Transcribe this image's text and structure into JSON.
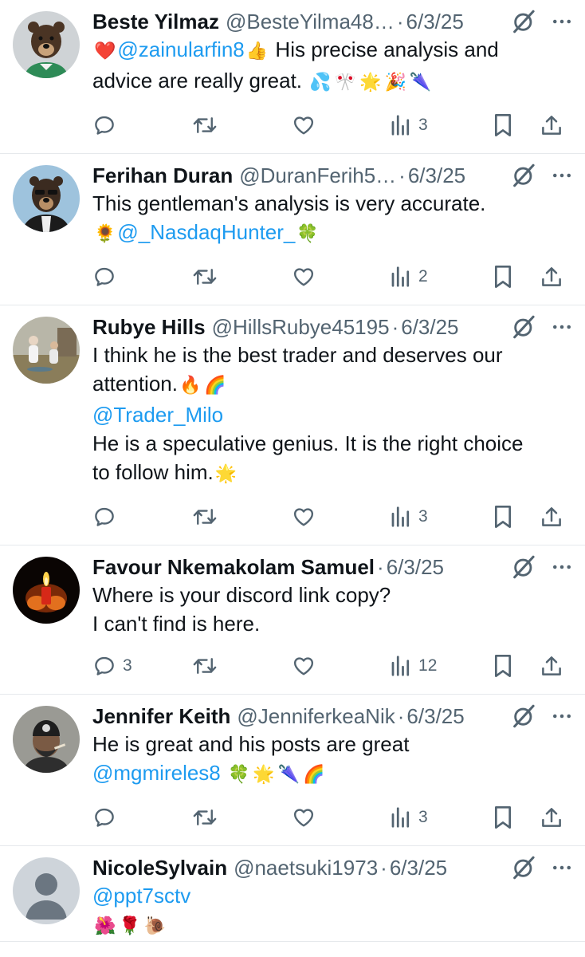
{
  "tweets": [
    {
      "name": "Beste Yilmaz",
      "handle": "@BesteYilma48…",
      "date": "6/3/25",
      "lines": [
        [
          {
            "t": "e",
            "v": "❤️"
          },
          {
            "t": "m",
            "v": "@zainularfin8"
          },
          {
            "t": "e",
            "v": "👍"
          },
          {
            "t": "x",
            "v": " His precise analysis and"
          }
        ],
        [
          {
            "t": "x",
            "v": "advice are really great. "
          },
          {
            "t": "e",
            "v": "💦"
          },
          {
            "t": "e",
            "v": "🎌"
          },
          {
            "t": "e",
            "v": "🌟"
          },
          {
            "t": "e",
            "v": "🎉"
          },
          {
            "t": "e",
            "v": "🌂"
          }
        ]
      ],
      "reply_count": "",
      "view_count": "3",
      "avatar": "bear-green"
    },
    {
      "name": "Ferihan Duran",
      "handle": "@DuranFerih5…",
      "date": "6/3/25",
      "lines": [
        [
          {
            "t": "x",
            "v": "This gentleman's analysis is very accurate."
          }
        ],
        [
          {
            "t": "e",
            "v": "🌻"
          },
          {
            "t": "m",
            "v": "@_NasdaqHunter_"
          },
          {
            "t": "e",
            "v": "🍀"
          }
        ]
      ],
      "reply_count": "",
      "view_count": "2",
      "avatar": "bear-blue"
    },
    {
      "name": "Rubye Hills",
      "handle": "@HillsRubye45195",
      "date": "6/3/25",
      "lines": [
        [
          {
            "t": "x",
            "v": "I think he is the best trader and deserves our"
          }
        ],
        [
          {
            "t": "x",
            "v": "attention."
          },
          {
            "t": "e",
            "v": "🔥"
          },
          {
            "t": "e",
            "v": "🌈"
          }
        ],
        [
          {
            "t": "m",
            "v": "@Trader_Milo"
          }
        ],
        [
          {
            "t": "x",
            "v": "He is a speculative genius. It is the right choice"
          }
        ],
        [
          {
            "t": "x",
            "v": "to follow him."
          },
          {
            "t": "e",
            "v": "🌟"
          }
        ]
      ],
      "reply_count": "",
      "view_count": "3",
      "avatar": "photo"
    },
    {
      "name": "Favour Nkemakolam Samuel",
      "handle": "",
      "date": "6/3/25",
      "lines": [
        [
          {
            "t": "x",
            "v": "Where is your discord link copy?"
          }
        ],
        [
          {
            "t": "x",
            "v": "I can't find is here."
          }
        ]
      ],
      "reply_count": "3",
      "view_count": "12",
      "avatar": "candle"
    },
    {
      "name": "Jennifer Keith",
      "handle": "@JenniferkeaNik",
      "date": "6/3/25",
      "lines": [
        [
          {
            "t": "x",
            "v": "He is great and his posts are great"
          }
        ],
        [
          {
            "t": "m",
            "v": "@mgmireles8"
          },
          {
            "t": "x",
            "v": " "
          },
          {
            "t": "e",
            "v": "🍀"
          },
          {
            "t": "e",
            "v": "🌟"
          },
          {
            "t": "e",
            "v": "🌂"
          },
          {
            "t": "e",
            "v": "🌈"
          }
        ]
      ],
      "reply_count": "",
      "view_count": "3",
      "avatar": "bitcoin"
    },
    {
      "name": "NicoleSylvain",
      "handle": "@naetsuki1973",
      "date": "6/3/25",
      "lines": [
        [
          {
            "t": "m",
            "v": "@ppt7sctv"
          }
        ],
        [
          {
            "t": "e",
            "v": "🌺"
          },
          {
            "t": "e",
            "v": "🌹"
          },
          {
            "t": "e",
            "v": "🐌"
          }
        ]
      ],
      "reply_count": "",
      "view_count": "",
      "avatar": "default"
    }
  ],
  "separator": "·",
  "colors": {
    "link": "#1d9bf0",
    "secondary": "#536471",
    "text": "#0f1419",
    "divider": "#e6e9ec"
  },
  "icons": [
    "reply-icon",
    "retweet-icon",
    "like-icon",
    "views-icon",
    "bookmark-icon",
    "share-icon",
    "grok-icon",
    "more-icon"
  ]
}
